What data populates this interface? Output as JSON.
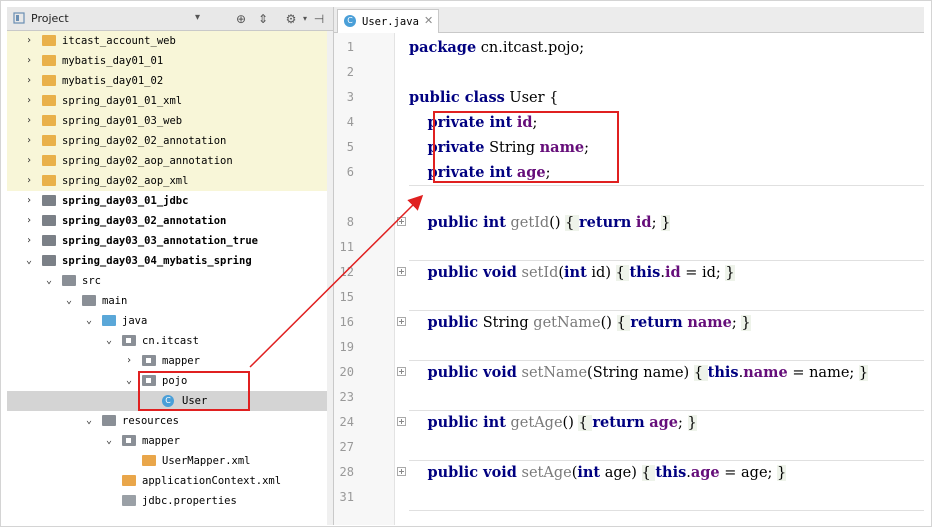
{
  "project_panel": {
    "title": "Project",
    "tree": [
      {
        "label": "itcast_account_web",
        "depth": 1,
        "expanded": false,
        "icon": "folder-orange",
        "highlight": true,
        "bold": false
      },
      {
        "label": "mybatis_day01_01",
        "depth": 1,
        "expanded": false,
        "icon": "folder-orange",
        "highlight": true,
        "bold": false
      },
      {
        "label": "mybatis_day01_02",
        "depth": 1,
        "expanded": false,
        "icon": "folder-orange",
        "highlight": true,
        "bold": false
      },
      {
        "label": "spring_day01_01_xml",
        "depth": 1,
        "expanded": false,
        "icon": "folder-orange",
        "highlight": true,
        "bold": false
      },
      {
        "label": "spring_day01_03_web",
        "depth": 1,
        "expanded": false,
        "icon": "folder-orange",
        "highlight": true,
        "bold": false
      },
      {
        "label": "spring_day02_02_annotation",
        "depth": 1,
        "expanded": false,
        "icon": "folder-orange",
        "highlight": true,
        "bold": false
      },
      {
        "label": "spring_day02_aop_annotation",
        "depth": 1,
        "expanded": false,
        "icon": "folder-orange",
        "highlight": true,
        "bold": false
      },
      {
        "label": "spring_day02_aop_xml",
        "depth": 1,
        "expanded": false,
        "icon": "folder-orange",
        "highlight": true,
        "bold": false
      },
      {
        "label": "spring_day03_01_jdbc",
        "depth": 1,
        "expanded": false,
        "icon": "folder-mod",
        "highlight": false,
        "bold": true
      },
      {
        "label": "spring_day03_02_annotation",
        "depth": 1,
        "expanded": false,
        "icon": "folder-mod",
        "highlight": false,
        "bold": true
      },
      {
        "label": "spring_day03_03_annotation_true",
        "depth": 1,
        "expanded": false,
        "icon": "folder-mod",
        "highlight": false,
        "bold": true
      },
      {
        "label": "spring_day03_04_mybatis_spring",
        "depth": 1,
        "expanded": true,
        "icon": "folder-mod",
        "highlight": false,
        "bold": true
      },
      {
        "label": "src",
        "depth": 2,
        "expanded": true,
        "icon": "folder-grey",
        "highlight": false,
        "bold": false
      },
      {
        "label": "main",
        "depth": 3,
        "expanded": true,
        "icon": "folder-grey",
        "highlight": false,
        "bold": false
      },
      {
        "label": "java",
        "depth": 4,
        "expanded": true,
        "icon": "folder-blue",
        "highlight": false,
        "bold": false
      },
      {
        "label": "cn.itcast",
        "depth": 5,
        "expanded": true,
        "icon": "pkg",
        "highlight": false,
        "bold": false
      },
      {
        "label": "mapper",
        "depth": 6,
        "expanded": false,
        "icon": "pkg",
        "highlight": false,
        "bold": false
      },
      {
        "label": "pojo",
        "depth": 6,
        "expanded": true,
        "icon": "pkg",
        "highlight": false,
        "bold": false
      },
      {
        "label": "User",
        "depth": 7,
        "expanded": null,
        "icon": "class",
        "highlight": false,
        "bold": false,
        "selected": true
      },
      {
        "label": "resources",
        "depth": 4,
        "expanded": true,
        "icon": "folder-grey",
        "highlight": false,
        "bold": false
      },
      {
        "label": "mapper",
        "depth": 5,
        "expanded": true,
        "icon": "pkg",
        "highlight": false,
        "bold": false
      },
      {
        "label": "UserMapper.xml",
        "depth": 6,
        "expanded": null,
        "icon": "xml",
        "highlight": false,
        "bold": false
      },
      {
        "label": "applicationContext.xml",
        "depth": 5,
        "expanded": null,
        "icon": "xml",
        "highlight": false,
        "bold": false
      },
      {
        "label": "jdbc.properties",
        "depth": 5,
        "expanded": null,
        "icon": "properties",
        "highlight": false,
        "bold": false
      }
    ]
  },
  "editor": {
    "tab_label": "User.java",
    "tab_icon_letter": "C",
    "lines": [
      {
        "num": "1",
        "fold": false,
        "sep": false,
        "tokens": [
          [
            "kw",
            "package"
          ],
          [
            "t",
            " cn.itcast.pojo;"
          ]
        ]
      },
      {
        "num": "2",
        "fold": false,
        "sep": false,
        "tokens": []
      },
      {
        "num": "3",
        "fold": false,
        "sep": false,
        "tokens": [
          [
            "kw",
            "public class"
          ],
          [
            "t",
            " User {"
          ]
        ]
      },
      {
        "num": "4",
        "fold": false,
        "sep": false,
        "tokens": [
          [
            "t",
            "    "
          ],
          [
            "kw",
            "private int"
          ],
          [
            "t",
            " "
          ],
          [
            "fld",
            "id"
          ],
          [
            "t",
            ";"
          ]
        ]
      },
      {
        "num": "5",
        "fold": false,
        "sep": false,
        "tokens": [
          [
            "t",
            "    "
          ],
          [
            "kw",
            "private"
          ],
          [
            "t",
            " String "
          ],
          [
            "fld",
            "name"
          ],
          [
            "t",
            ";"
          ]
        ]
      },
      {
        "num": "6",
        "fold": false,
        "sep": false,
        "tokens": [
          [
            "t",
            "    "
          ],
          [
            "kw",
            "private int"
          ],
          [
            "t",
            " "
          ],
          [
            "fld",
            "age"
          ],
          [
            "t",
            ";"
          ]
        ]
      },
      {
        "num": "",
        "fold": false,
        "sep": true,
        "tokens": []
      },
      {
        "num": "8",
        "fold": true,
        "sep": false,
        "tokens": [
          [
            "t",
            "    "
          ],
          [
            "kw",
            "public int"
          ],
          [
            "t",
            " "
          ],
          [
            "mth",
            "getId"
          ],
          [
            "t",
            "() "
          ],
          [
            "br",
            "{ "
          ],
          [
            "kw",
            "return"
          ],
          [
            "t",
            " "
          ],
          [
            "fld",
            "id"
          ],
          [
            "t",
            "; "
          ],
          [
            "br",
            "}"
          ]
        ]
      },
      {
        "num": "11",
        "fold": false,
        "sep": false,
        "tokens": []
      },
      {
        "num": "12",
        "fold": true,
        "sep": true,
        "tokens": [
          [
            "t",
            "    "
          ],
          [
            "kw",
            "public void"
          ],
          [
            "t",
            " "
          ],
          [
            "mth",
            "setId"
          ],
          [
            "t",
            "("
          ],
          [
            "kw",
            "int"
          ],
          [
            "t",
            " id) "
          ],
          [
            "br",
            "{ "
          ],
          [
            "kw",
            "this"
          ],
          [
            "t",
            "."
          ],
          [
            "fld",
            "id"
          ],
          [
            "t",
            " = id; "
          ],
          [
            "br",
            "}"
          ]
        ]
      },
      {
        "num": "15",
        "fold": false,
        "sep": false,
        "tokens": []
      },
      {
        "num": "16",
        "fold": true,
        "sep": true,
        "tokens": [
          [
            "t",
            "    "
          ],
          [
            "kw",
            "public"
          ],
          [
            "t",
            " String "
          ],
          [
            "mth",
            "getName"
          ],
          [
            "t",
            "() "
          ],
          [
            "br",
            "{ "
          ],
          [
            "kw",
            "return"
          ],
          [
            "t",
            " "
          ],
          [
            "fld",
            "name"
          ],
          [
            "t",
            "; "
          ],
          [
            "br",
            "}"
          ]
        ]
      },
      {
        "num": "19",
        "fold": false,
        "sep": false,
        "tokens": []
      },
      {
        "num": "20",
        "fold": true,
        "sep": true,
        "tokens": [
          [
            "t",
            "    "
          ],
          [
            "kw",
            "public void"
          ],
          [
            "t",
            " "
          ],
          [
            "mth",
            "setName"
          ],
          [
            "t",
            "(String name) "
          ],
          [
            "br",
            "{ "
          ],
          [
            "kw",
            "this"
          ],
          [
            "t",
            "."
          ],
          [
            "fld",
            "name"
          ],
          [
            "t",
            " = name; "
          ],
          [
            "br",
            "}"
          ]
        ]
      },
      {
        "num": "23",
        "fold": false,
        "sep": false,
        "tokens": []
      },
      {
        "num": "24",
        "fold": true,
        "sep": true,
        "tokens": [
          [
            "t",
            "    "
          ],
          [
            "kw",
            "public int"
          ],
          [
            "t",
            " "
          ],
          [
            "mth",
            "getAge"
          ],
          [
            "t",
            "() "
          ],
          [
            "br",
            "{ "
          ],
          [
            "kw",
            "return"
          ],
          [
            "t",
            " "
          ],
          [
            "fld",
            "age"
          ],
          [
            "t",
            "; "
          ],
          [
            "br",
            "}"
          ]
        ]
      },
      {
        "num": "27",
        "fold": false,
        "sep": false,
        "tokens": []
      },
      {
        "num": "28",
        "fold": true,
        "sep": true,
        "tokens": [
          [
            "t",
            "    "
          ],
          [
            "kw",
            "public void"
          ],
          [
            "t",
            " "
          ],
          [
            "mth",
            "setAge"
          ],
          [
            "t",
            "("
          ],
          [
            "kw",
            "int"
          ],
          [
            "t",
            " age) "
          ],
          [
            "br",
            "{ "
          ],
          [
            "kw",
            "this"
          ],
          [
            "t",
            "."
          ],
          [
            "fld",
            "age"
          ],
          [
            "t",
            " = age; "
          ],
          [
            "br",
            "}"
          ]
        ]
      },
      {
        "num": "31",
        "fold": false,
        "sep": false,
        "tokens": []
      },
      {
        "num": "",
        "fold": false,
        "sep": true,
        "tokens": []
      }
    ]
  },
  "annotation": {
    "color": "#e02020"
  }
}
